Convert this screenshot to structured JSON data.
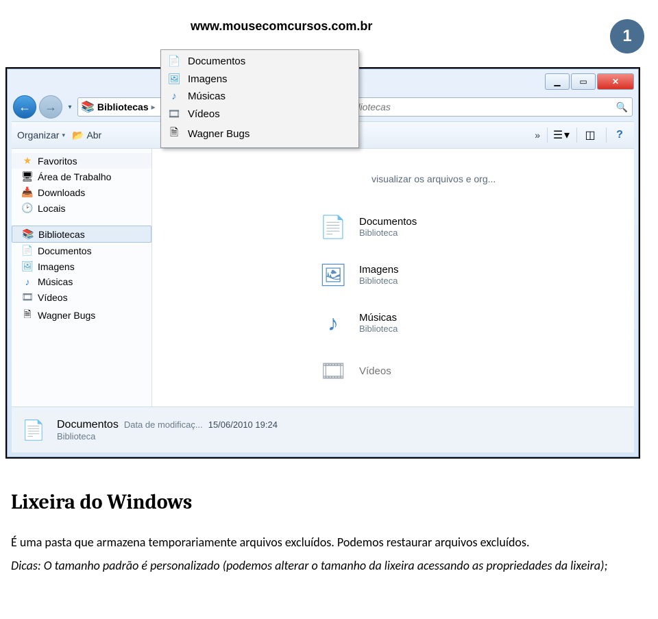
{
  "doc": {
    "url": "www.mousecomcursos.com.br",
    "page_number": "1"
  },
  "window": {
    "min_glyph": "▁",
    "max_glyph": "▭",
    "close_glyph": "✕"
  },
  "nav": {
    "back": "←",
    "forward": "→",
    "history_drop": "▾",
    "breadcrumb_label": "Bibliotecas",
    "breadcrumb_sep": "▸",
    "refresh": "↻"
  },
  "search": {
    "placeholder": "Pesquisar Bibliotecas",
    "icon": "🔍"
  },
  "toolbar": {
    "organize": "Organizar",
    "open": "Abr",
    "overflow": "»",
    "view_drop": "▾",
    "help": "?"
  },
  "dropdown": [
    {
      "icon": "📄",
      "label": "Documentos"
    },
    {
      "icon": "🖼",
      "label": "Imagens"
    },
    {
      "icon": "♪",
      "label": "Músicas"
    },
    {
      "icon": "🎞",
      "label": "Vídeos"
    },
    {
      "icon": "🗎",
      "label": "Wagner Bugs"
    }
  ],
  "sidebar": {
    "favorites": {
      "head": "Favoritos",
      "items": [
        {
          "icon": "🖥",
          "label": "Área de Trabalho"
        },
        {
          "icon": "📥",
          "label": "Downloads"
        },
        {
          "icon": "📍",
          "label": "Locais"
        }
      ]
    },
    "libraries": {
      "head": "Bibliotecas",
      "items": [
        {
          "icon": "📄",
          "label": "Documentos"
        },
        {
          "icon": "🖼",
          "label": "Imagens"
        },
        {
          "icon": "♪",
          "label": "Músicas"
        },
        {
          "icon": "🎞",
          "label": "Vídeos"
        },
        {
          "icon": "🗎",
          "label": "Wagner Bugs"
        }
      ]
    }
  },
  "main": {
    "hint": "visualizar os arquivos e org...",
    "type_label": "Biblioteca",
    "items": [
      {
        "thumb": "📄",
        "name": "Documentos"
      },
      {
        "thumb": "🖼",
        "name": "Imagens"
      },
      {
        "thumb": "♪",
        "name": "Músicas"
      },
      {
        "thumb": "🎞",
        "name": "Vídeos"
      }
    ]
  },
  "status": {
    "name": "Documentos",
    "mod_label": "Data de modificaç...",
    "mod_value": "15/06/2010 19:24",
    "sub": "Biblioteca"
  },
  "article": {
    "heading": "Lixeira do Windows",
    "p1": "É uma pasta que armazena temporariamente arquivos excluídos. Podemos restaurar arquivos excluídos.",
    "p2": "Dicas: O tamanho padrão é personalizado (podemos alterar o tamanho da lixeira acessando as propriedades da lixeira);"
  }
}
